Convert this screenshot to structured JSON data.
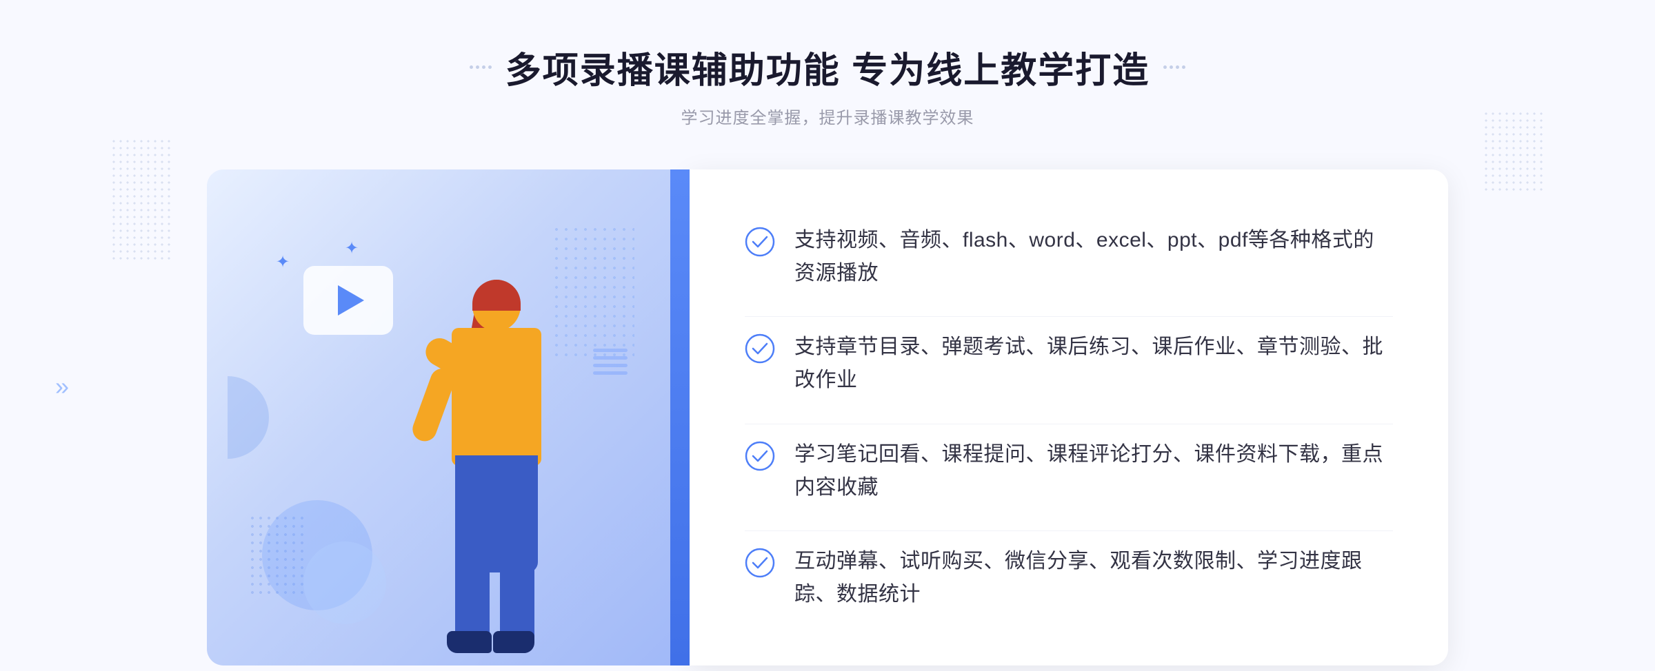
{
  "page": {
    "background": "#f8f9ff"
  },
  "header": {
    "title": "多项录播课辅助功能 专为线上教学打造",
    "subtitle": "学习进度全掌握，提升录播课教学效果",
    "decorator_left": "decorators",
    "decorator_right": "decorators"
  },
  "features": [
    {
      "id": 1,
      "text": "支持视频、音频、flash、word、excel、ppt、pdf等各种格式的资源播放"
    },
    {
      "id": 2,
      "text": "支持章节目录、弹题考试、课后练习、课后作业、章节测验、批改作业"
    },
    {
      "id": 3,
      "text": "学习笔记回看、课程提问、课程评论打分、课件资料下载，重点内容收藏"
    },
    {
      "id": 4,
      "text": "互动弹幕、试听购买、微信分享、观看次数限制、学习进度跟踪、数据统计"
    }
  ],
  "colors": {
    "accent_blue": "#4d7ef8",
    "text_dark": "#1a1a2e",
    "text_gray": "#999aaa",
    "check_color": "#4d7ef8"
  },
  "icons": {
    "check": "check-circle-icon",
    "play": "play-icon",
    "chevron": "chevron-icon"
  }
}
